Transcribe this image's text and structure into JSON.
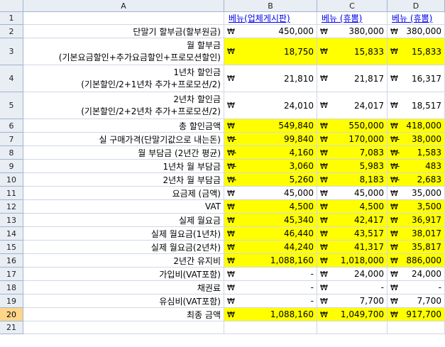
{
  "columns": [
    "A",
    "B",
    "C",
    "D"
  ],
  "rows": [
    {
      "num": "1",
      "label": "",
      "vals": [
        "베뉴(업체게시판)",
        "베뉴 (휴뽐)",
        "베뉴 (휴뽐)"
      ],
      "header": true
    },
    {
      "num": "2",
      "label": "단말기 할부금(할부원금)",
      "vals": [
        "450,000",
        "380,000",
        "380,000"
      ]
    },
    {
      "num": "3",
      "label": "월 할부금",
      "label2": "(기본요금할인+추가요금할인+프로모션할인)",
      "vals": [
        "18,750",
        "15,833",
        "15,833"
      ],
      "yellow": true
    },
    {
      "num": "4",
      "label": "1년차 할인금",
      "label2": "(기본할인/2+1년차 추가+프로모션/2)",
      "vals": [
        "21,810",
        "21,817",
        "16,317"
      ]
    },
    {
      "num": "5",
      "label": "2년차 할인금",
      "label2": "(기본할인/2+2년차 추가+프로모션/2)",
      "vals": [
        "24,010",
        "24,017",
        "18,517"
      ]
    },
    {
      "num": "6",
      "label": "총 할인금액",
      "vals": [
        "549,840",
        "550,000",
        "418,000"
      ],
      "yellow": true
    },
    {
      "num": "7",
      "label": "실 구매가격(단말기값으로 내는돈)",
      "vals": [
        "99,840",
        "170,000",
        "38,000"
      ],
      "yellow": true,
      "neg": [
        true,
        false,
        true
      ]
    },
    {
      "num": "8",
      "label": "월 부담금 (2년간 평균)",
      "vals": [
        "4,160",
        "7,083",
        "1,583"
      ],
      "yellow": true,
      "neg": [
        true,
        false,
        true
      ]
    },
    {
      "num": "9",
      "label": "1년차 월 부담금",
      "vals": [
        "3,060",
        "5,983",
        "483"
      ],
      "yellow": true,
      "neg": [
        true,
        false,
        true
      ]
    },
    {
      "num": "10",
      "label": "2년차 월 부담금",
      "vals": [
        "5,260",
        "8,183",
        "2,683"
      ],
      "yellow": true,
      "neg": [
        true,
        false,
        true
      ]
    },
    {
      "num": "11",
      "label": "요금제 (금액)",
      "vals": [
        "45,000",
        "45,000",
        "35,000"
      ]
    },
    {
      "num": "12",
      "label": "VAT",
      "vals": [
        "4,500",
        "4,500",
        "3,500"
      ],
      "yellow": true
    },
    {
      "num": "13",
      "label": "실제 월요금",
      "vals": [
        "45,340",
        "42,417",
        "36,917"
      ],
      "yellow": true
    },
    {
      "num": "14",
      "label": "실제 월요금(1년차)",
      "vals": [
        "46,440",
        "43,517",
        "38,017"
      ],
      "yellow": true
    },
    {
      "num": "15",
      "label": "실제 월요금(2년차)",
      "vals": [
        "44,240",
        "41,317",
        "35,817"
      ],
      "yellow": true
    },
    {
      "num": "16",
      "label": "2년간 유지비",
      "vals": [
        "1,088,160",
        "1,018,000",
        "886,000"
      ],
      "yellow": true
    },
    {
      "num": "17",
      "label": "가입비(VAT포함)",
      "vals": [
        "-",
        "24,000",
        "24,000"
      ]
    },
    {
      "num": "18",
      "label": "채권료",
      "vals": [
        "-",
        "-",
        "-"
      ]
    },
    {
      "num": "19",
      "label": "유심비(VAT포함)",
      "vals": [
        "-",
        "7,700",
        "7,700"
      ]
    },
    {
      "num": "20",
      "label": "최종 금액",
      "vals": [
        "1,088,160",
        "1,049,700",
        "917,700"
      ],
      "yellow": true,
      "selected": true
    },
    {
      "num": "21",
      "label": "",
      "vals": [
        "",
        "",
        ""
      ],
      "empty": true
    }
  ],
  "currency_symbol": "₩",
  "highlight_color": "#ffff00"
}
